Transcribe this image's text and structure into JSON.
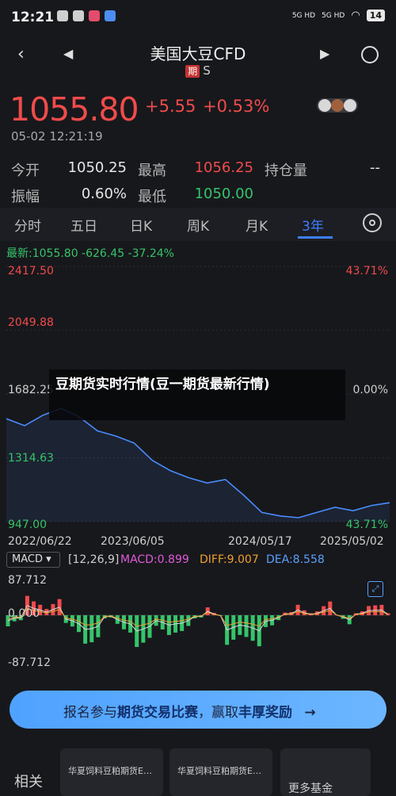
{
  "status": {
    "time": "12:21",
    "net1": "5G HD",
    "net2": "5G HD",
    "battery": "14"
  },
  "nav": {
    "title": "美国大豆CFD",
    "badge": "期",
    "sub": "S"
  },
  "quote": {
    "price": "1055.80",
    "change": "+5.55",
    "pct": "+0.53%",
    "time": "05-02 12:21:19",
    "open_label": "今开",
    "open": "1050.25",
    "high_label": "最高",
    "high": "1056.25",
    "oi_label": "持仓量",
    "oi": "--",
    "amp_label": "振幅",
    "amp": "0.60%",
    "low_label": "最低",
    "low": "1050.00"
  },
  "tabs": [
    "分时",
    "五日",
    "日K",
    "周K",
    "月K",
    "3年"
  ],
  "chart": {
    "latest": "最新:1055.80  -626.45  -37.24%",
    "y_left": [
      "2417.50",
      "2049.88",
      "1682.25",
      "1314.63",
      "947.00"
    ],
    "y_right": [
      "43.71%",
      "0.00%",
      "43.71%"
    ],
    "dates": [
      "2022/06/22",
      "2023/06/05",
      "2024/05/17",
      "2025/05/02"
    ]
  },
  "chart_data": {
    "type": "line",
    "x": [
      "2022/06/22",
      "2023/06/05",
      "2024/05/17",
      "2025/05/02"
    ],
    "ylim": [
      947.0,
      2417.5
    ],
    "series": [
      {
        "values": [
          1540,
          1500,
          1560,
          1600,
          1550,
          1470,
          1440,
          1400,
          1300,
          1240,
          1200,
          1170,
          1190,
          1100,
          1000,
          980,
          970,
          1000,
          1030,
          1010,
          1040,
          1056
        ]
      }
    ],
    "macd": {
      "label": "MACD",
      "params": "[12,26,9]",
      "macd": "MACD:0.899",
      "diff": "DIFF:9.007",
      "dea": "DEA:8.558",
      "top": "87.712",
      "zero": "0.000",
      "bottom": "-87.712"
    }
  },
  "overlay": {
    "text": "豆​期货实时行情(豆一期货最新行情)"
  },
  "banner": {
    "pre": "报名参与",
    "bold1": "期货交易比赛",
    "mid": "，赢取",
    "bold2": "丰厚奖励",
    "arrow": "→"
  },
  "related": {
    "label": "相关",
    "cards": [
      "华夏饲料豆粕期货E…",
      "华夏饲料豆粕期货E…"
    ],
    "more": "更多基金"
  },
  "colors": {
    "up": "#f04b4b",
    "down": "#35c46a",
    "accent": "#3c7fff",
    "line": "#4a8cff"
  }
}
